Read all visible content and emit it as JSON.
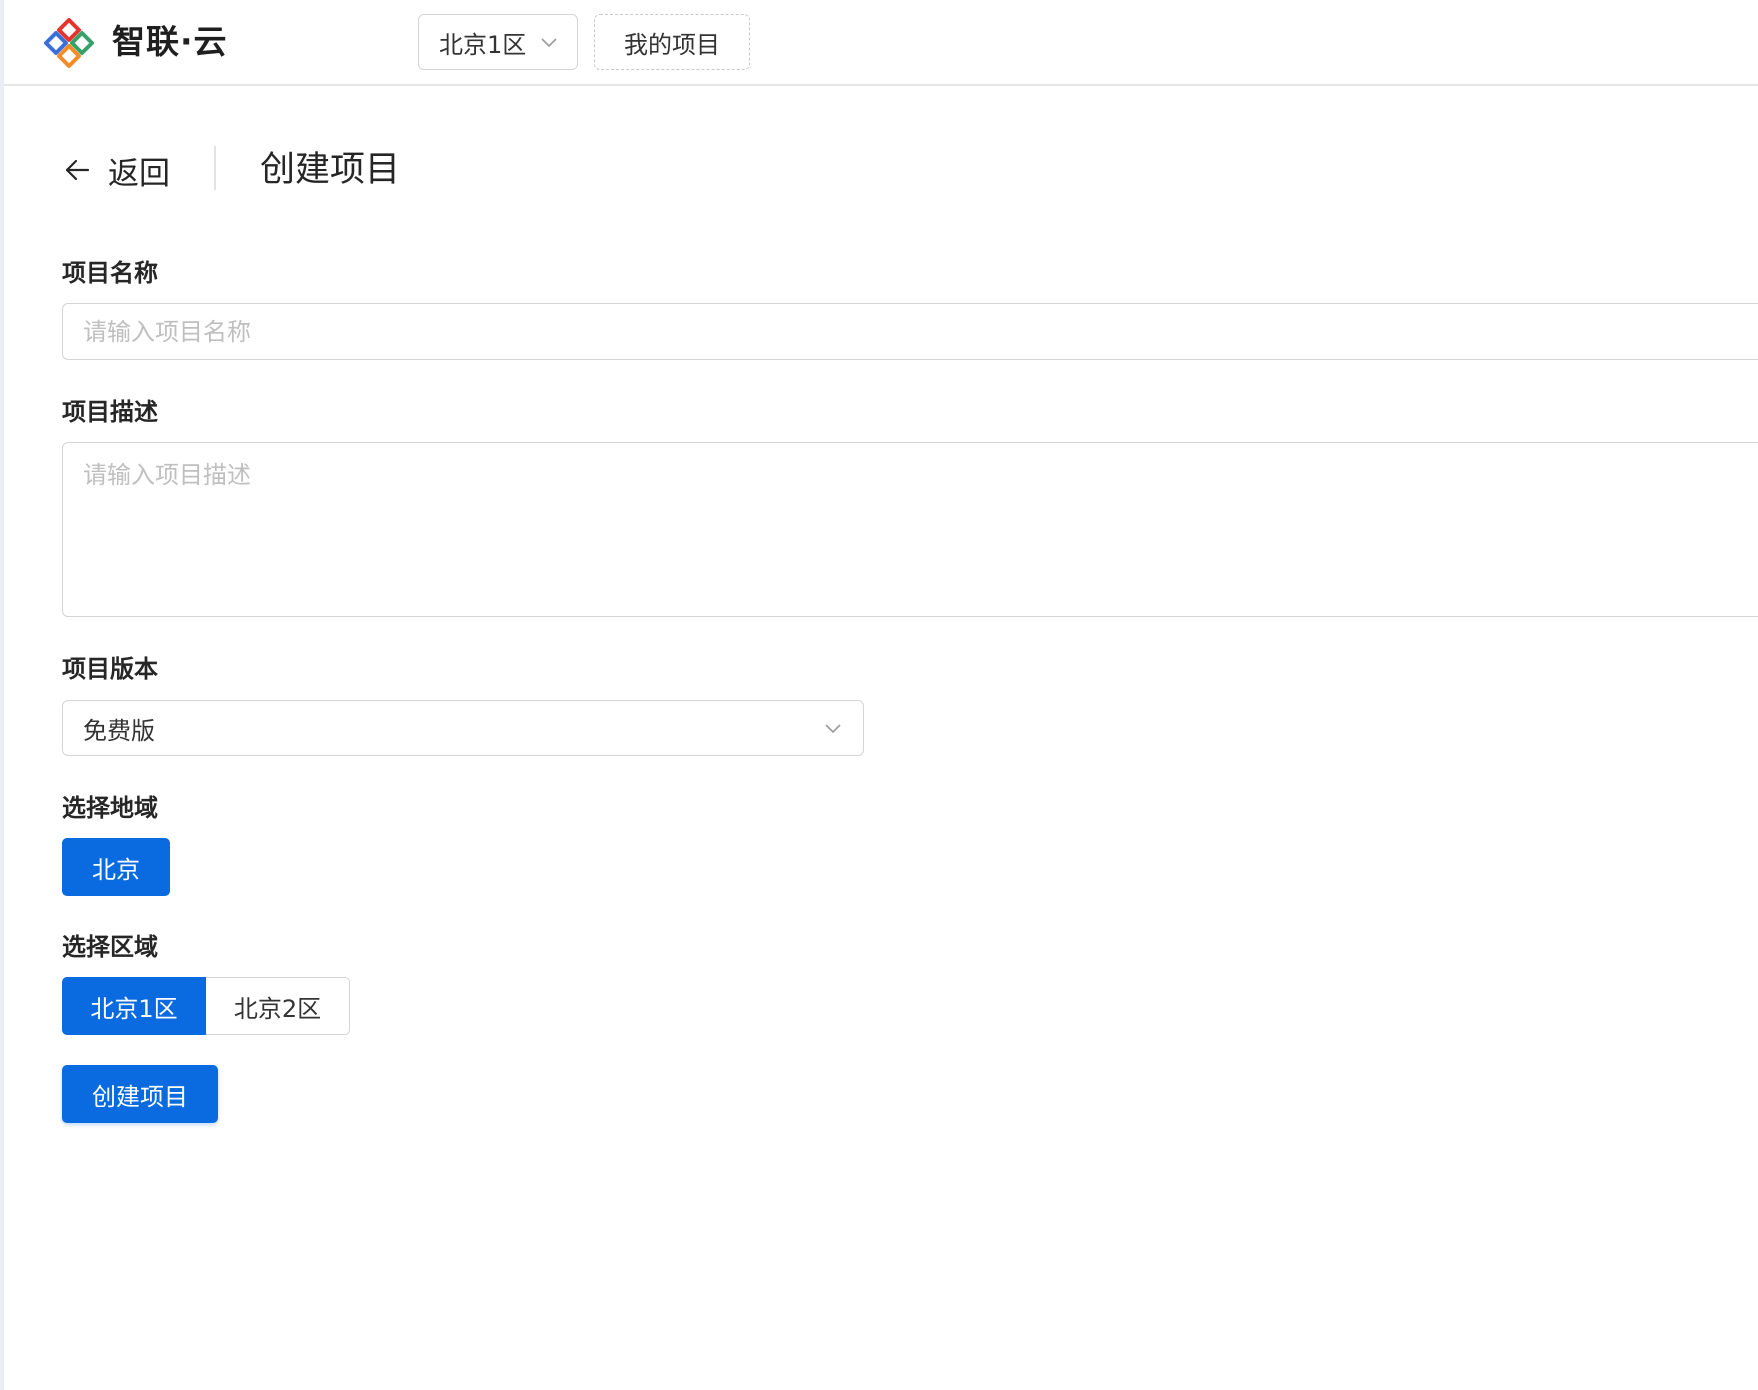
{
  "app": {
    "brand": "智联·云",
    "accent_color": "#0a6be0"
  },
  "header": {
    "region_select": {
      "value": "北京1区",
      "icon": "chevron-down-icon"
    },
    "my_projects_label": "我的项目"
  },
  "page": {
    "back_label": "返回",
    "back_icon": "arrow-left-icon",
    "title": "创建项目"
  },
  "form": {
    "name": {
      "label": "项目名称",
      "value": "",
      "placeholder": "请输入项目名称"
    },
    "description": {
      "label": "项目描述",
      "value": "",
      "placeholder": "请输入项目描述"
    },
    "version": {
      "label": "项目版本",
      "selected": "免费版",
      "icon": "chevron-down-icon"
    },
    "region": {
      "label": "选择地域",
      "options": [
        "北京"
      ],
      "selected": "北京"
    },
    "zone": {
      "label": "选择区域",
      "options": [
        "北京1区",
        "北京2区"
      ],
      "selected": "北京1区"
    },
    "submit_label": "创建项目"
  }
}
